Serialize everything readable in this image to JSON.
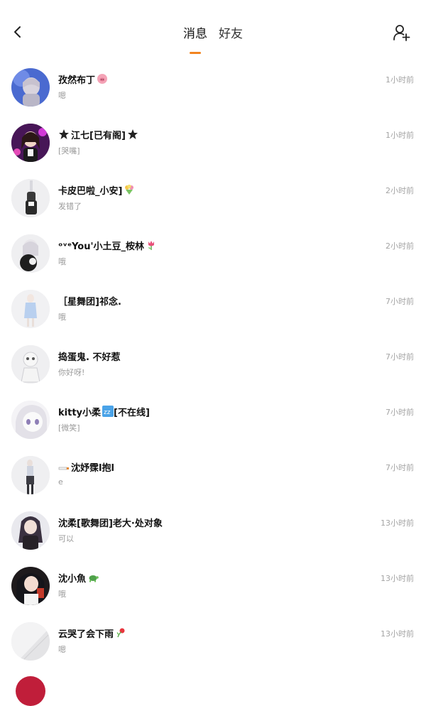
{
  "header": {
    "back_icon": "chevron-left-icon",
    "tabs": [
      {
        "label": "消息",
        "active": true
      },
      {
        "label": "好友",
        "active": false
      }
    ],
    "add_friend_icon": "add-user-icon",
    "accent_color": "#f2841f"
  },
  "conversations": [
    {
      "name": "孜然布丁",
      "badge": "pig-emoji",
      "preview": "嗯",
      "time": "1小时前"
    },
    {
      "name": "江七[已有阁]",
      "prefix": "star-icon",
      "badge": "star-icon",
      "preview": "[哭嘴]",
      "time": "1小时前"
    },
    {
      "name": "卡皮巴啦_小安]",
      "badge": "bouquet-emoji",
      "preview": "发错了",
      "time": "2小时前"
    },
    {
      "name": "ᵒᵛᵉYou'小土豆_桉林",
      "badge": "tulip-emoji",
      "preview": "哦",
      "time": "2小时前"
    },
    {
      "name": "［星舞团]祁念.",
      "preview": "哦",
      "time": "7小时前"
    },
    {
      "name": "捣蛋鬼. 不好惹",
      "preview": "你好呀!",
      "time": "7小时前"
    },
    {
      "name": "kitty小柔",
      "badge": "zzz-emoji",
      "name_suffix": "[不在线]",
      "preview": "[微笑]",
      "time": "7小时前"
    },
    {
      "name": "沈妤霂l抱l",
      "prefix": "cigarette-emoji",
      "preview": "e",
      "time": "7小时前"
    },
    {
      "name": "沈柔[歌舞团]老大·处对象",
      "preview": "可以",
      "time": "13小时前"
    },
    {
      "name": "沈小魚",
      "badge": "turtle-emoji",
      "preview": "哦",
      "time": "13小时前"
    },
    {
      "name": "云哭了会下雨",
      "badge": "flower-emoji",
      "preview": "嗯",
      "time": "13小时前"
    }
  ]
}
